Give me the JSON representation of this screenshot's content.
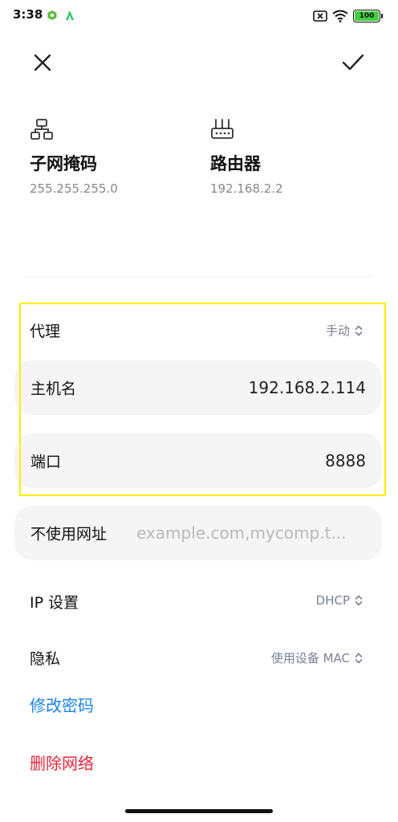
{
  "status_bar": {
    "time": "3:38",
    "battery_level": "100",
    "icons": [
      "app-icon-green",
      "app-icon-a",
      "no-sim-icon",
      "wifi-icon",
      "battery-icon"
    ]
  },
  "toolbar": {
    "close_icon": "close-icon",
    "confirm_icon": "check-icon"
  },
  "network_info": {
    "subnet": {
      "icon": "network-tree-icon",
      "title": "子网掩码",
      "value": "255.255.255.0"
    },
    "router": {
      "icon": "router-icon",
      "title": "路由器",
      "value": "192.168.2.2"
    }
  },
  "proxy": {
    "label": "代理",
    "mode": "手动",
    "hostname_label": "主机名",
    "hostname_value": "192.168.2.114",
    "port_label": "端口",
    "port_value": "8888",
    "bypass_label": "不使用网址",
    "bypass_placeholder": "example.com,mycomp.t..."
  },
  "ip_settings": {
    "label": "IP 设置",
    "value": "DHCP"
  },
  "privacy": {
    "label": "隐私",
    "value": "使用设备 MAC"
  },
  "actions": {
    "change_password": "修改密码",
    "delete_network": "删除网络"
  },
  "colors": {
    "link_blue": "#1a83f0",
    "delete_red": "#f0233a",
    "highlight_yellow": "#ffec00",
    "pill_bg": "#f5f5f5"
  }
}
